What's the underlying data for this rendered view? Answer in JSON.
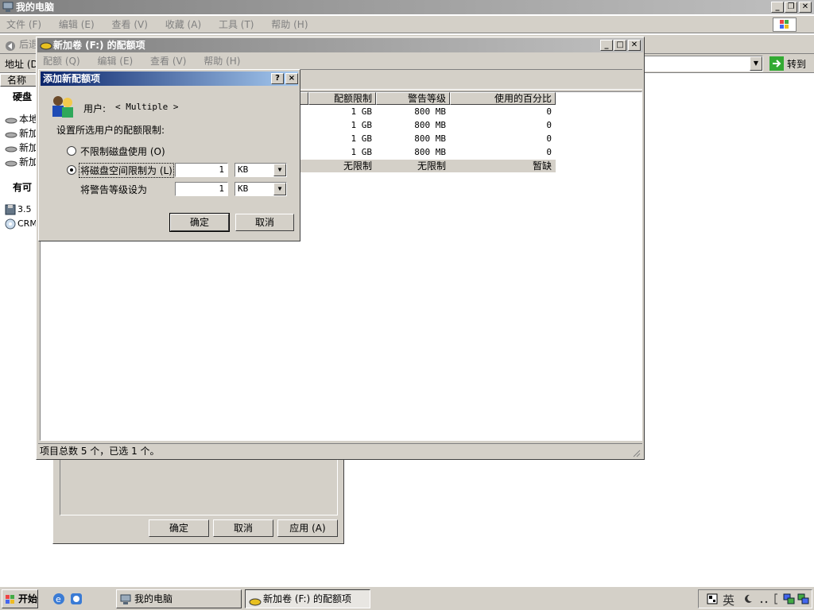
{
  "explorer": {
    "title": "我的电脑",
    "menu": [
      "文件 (F)",
      "编辑 (E)",
      "查看 (V)",
      "收藏 (A)",
      "工具 (T)",
      "帮助 (H)"
    ],
    "back_label": "后退",
    "address_label": "地址 (D)",
    "go_label": "转到",
    "name_col": "名称",
    "left_items": [
      {
        "label": "硬盘",
        "bold": true
      },
      {
        "label": "本地"
      },
      {
        "label": "新加"
      },
      {
        "label": "新加"
      },
      {
        "label": "新加"
      },
      {
        "label": "有可",
        "bold": true
      },
      {
        "label": "3.5"
      },
      {
        "label": "CRM"
      }
    ]
  },
  "props_dialog": {
    "ok": "确定",
    "cancel": "取消",
    "apply": "应用 (A)"
  },
  "quota_window": {
    "title": "新加卷 (F:) 的配额项",
    "menu": [
      "配额 (Q)",
      "编辑 (E)",
      "查看 (V)",
      "帮助 (H)"
    ],
    "columns": [
      "配额限制",
      "警告等级",
      "使用的百分比"
    ],
    "rows": [
      {
        "limit": "1 GB",
        "warn": "800 MB",
        "pct": "0"
      },
      {
        "limit": "1 GB",
        "warn": "800 MB",
        "pct": "0"
      },
      {
        "limit": "1 GB",
        "warn": "800 MB",
        "pct": "0"
      },
      {
        "limit": "1 GB",
        "warn": "800 MB",
        "pct": "0"
      },
      {
        "limit": "无限制",
        "warn": "无限制",
        "pct": "暂缺"
      }
    ],
    "status": "项目总数 5 个，已选 1 个。"
  },
  "add_dialog": {
    "title": "添加新配额项",
    "user_label": "用户:",
    "user_value": "< Multiple >",
    "instruction": "设置所选用户的配额限制:",
    "radio_unlimited": "不限制磁盘使用 (O)",
    "radio_limit": "将磁盘空间限制为 (L)",
    "warn_label": "将警告等级设为",
    "limit_value": "1",
    "limit_unit": "KB",
    "warn_value": "1",
    "warn_unit": "KB",
    "ok": "确定",
    "cancel": "取消",
    "help_btn": "?",
    "close_btn": "×"
  },
  "taskbar": {
    "start": "开始",
    "tasks": [
      "我的电脑",
      "新加卷 (F:) 的配额项"
    ],
    "tray_text": "英"
  }
}
